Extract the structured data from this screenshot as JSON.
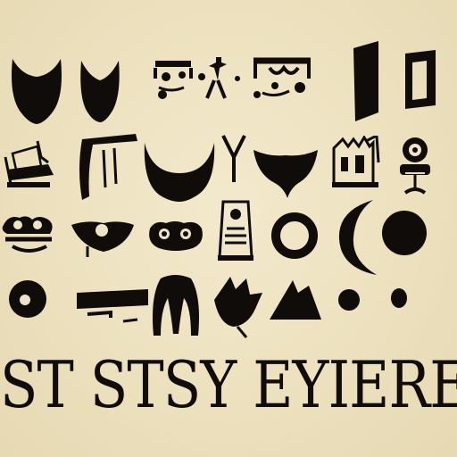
{
  "caption": {
    "text": "ST STSY EYIERE"
  },
  "colors": {
    "background": "#efe4c5",
    "ink": "#0f0c09"
  },
  "glyphs": [
    "crescent-icon",
    "crescent-icon",
    "face-icon",
    "face-icon",
    "bracket-icon",
    "bracket-icon",
    "book-icon",
    "bracket-icon",
    "crescent-icon",
    "letter-y-icon",
    "shield-icon",
    "castle-icon",
    "robot-icon",
    "face-icon",
    "mask-icon",
    "face-icon",
    "tower-icon",
    "ring-icon",
    "crescent-icon",
    "circle-icon",
    "circle-icon",
    "mouth-icon",
    "arch-icon",
    "leaf-icon",
    "triangle-icon",
    "dot-icon",
    "dot-icon"
  ]
}
